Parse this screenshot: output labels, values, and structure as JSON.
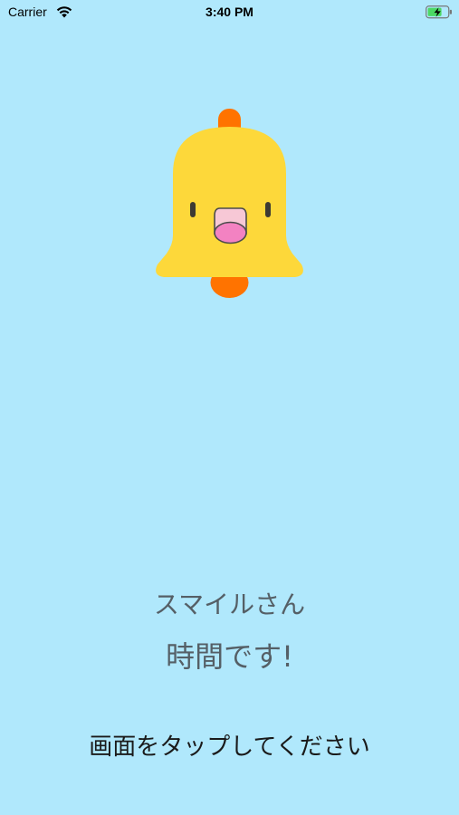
{
  "status_bar": {
    "carrier": "Carrier",
    "time": "3:40 PM",
    "wifi_icon": "wifi-icon",
    "battery_icon": "battery-charging-icon",
    "battery_color": "#4cd964"
  },
  "alarm": {
    "icon": "bell-character-icon",
    "name": "スマイルさん",
    "message": "時間です!",
    "tap_prompt": "画面をタップしてください"
  },
  "colors": {
    "background": "#b0e8fc",
    "bell_body": "#fdd83a",
    "bell_top_and_clapper": "#ff7300",
    "mouth": "#f382c2"
  }
}
